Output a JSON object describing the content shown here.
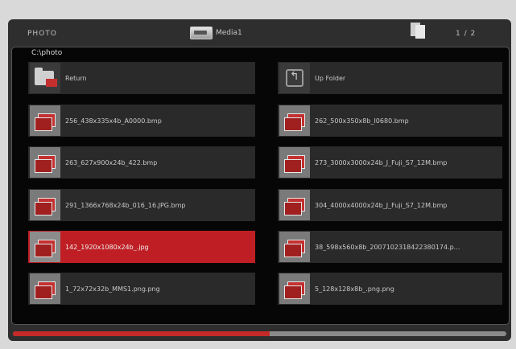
{
  "header": {
    "section_label": "PHOTO",
    "device_label": "Media1",
    "page_indicator": "1 / 2"
  },
  "path": "C:\\photo",
  "items": [
    {
      "name": "Return",
      "icon": "return-folder-icon",
      "selected": false
    },
    {
      "name": "Up  Folder",
      "icon": "up-folder-icon",
      "selected": false
    },
    {
      "name": "256_438x335x4b_A0000.bmp",
      "icon": "photo-icon",
      "selected": false
    },
    {
      "name": "262_500x350x8b_I0680.bmp",
      "icon": "photo-icon",
      "selected": false
    },
    {
      "name": "263_627x900x24b_422.bmp",
      "icon": "photo-icon",
      "selected": false
    },
    {
      "name": "273_3000x3000x24b_J_Fuji_S7_12M.bmp",
      "icon": "photo-icon",
      "selected": false
    },
    {
      "name": "291_1366x768x24b_016_16.JPG.bmp",
      "icon": "photo-icon",
      "selected": false
    },
    {
      "name": "304_4000x4000x24b_J_Fuji_S7_12M.bmp",
      "icon": "photo-icon",
      "selected": false
    },
    {
      "name": "142_1920x1080x24b_.jpg",
      "icon": "photo-icon",
      "selected": true
    },
    {
      "name": "38_598x560x8b_2007102318422380174.p...",
      "icon": "photo-icon",
      "selected": false
    },
    {
      "name": "1_72x72x32b_MMS1.png.png",
      "icon": "photo-icon",
      "selected": false
    },
    {
      "name": "5_128x128x8b_.png.png",
      "icon": "photo-icon",
      "selected": false
    }
  ],
  "progress": 0.52,
  "colors": {
    "accent": "#bf1f24",
    "background": "#060606",
    "item": "#2a2a2a"
  }
}
